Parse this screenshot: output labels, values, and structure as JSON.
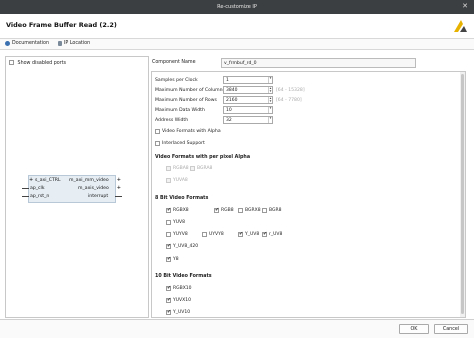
{
  "window": {
    "title": "Re-customize IP",
    "close_glyph": "✕"
  },
  "header": {
    "ip_title": "Video Frame Buffer Read (2.2)",
    "logo_icon": "xilinx-logo-icon",
    "logo_color": "#e8b200"
  },
  "nav": {
    "documentation": "Documentation",
    "ip_location": "IP Location"
  },
  "left": {
    "show_disabled_ports": "Show disabled ports",
    "block": {
      "ports_left": [
        "s_axi_CTRL",
        "ap_clk",
        "ap_rst_n"
      ],
      "ports_right": [
        "m_axi_mm_video",
        "m_axis_video",
        "interrupt"
      ]
    }
  },
  "component": {
    "label": "Component Name",
    "value": "v_frmbuf_rd_0"
  },
  "params": {
    "samples_per_clock": {
      "label": "Samples per Clock",
      "value": "1"
    },
    "max_columns": {
      "label": "Maximum Number of Columns",
      "value": "3840",
      "range": "[64 - 15328]"
    },
    "max_rows": {
      "label": "Maximum Number of Rows",
      "value": "2160",
      "range": "[64 - 7780]"
    },
    "max_data_width": {
      "label": "Maximum Data Width",
      "value": "10"
    },
    "address_width": {
      "label": "Address Width",
      "value": "32"
    },
    "video_formats_alpha": {
      "label": "Video Formats with Alpha",
      "checked": false
    },
    "interlaced": {
      "label": "Interlaced Support",
      "checked": false
    }
  },
  "sections": {
    "alpha": {
      "title": "Video Formats with per pixel Alpha",
      "row1": [
        "RGBA8",
        "BGRA8"
      ],
      "row2": [
        "YUVA8"
      ]
    },
    "bit8": {
      "title": "8 Bit Video Formats",
      "row1": [
        {
          "l": "RGBX8",
          "c": true
        },
        {
          "l": "RGB8",
          "c": true
        },
        {
          "l": "BGRX8",
          "c": false
        },
        {
          "l": "BGR8",
          "c": false
        }
      ],
      "row2": [
        {
          "l": "YUV8",
          "c": false
        }
      ],
      "row3": [
        {
          "l": "YUYV8",
          "c": false
        },
        {
          "l": "UYVY8",
          "c": false
        },
        {
          "l": "Y_UV8",
          "c": true
        },
        {
          "l": "r_UV8",
          "c": true
        }
      ],
      "row4": [
        {
          "l": "Y_UV8_420",
          "c": true
        }
      ],
      "row5": [
        {
          "l": "Y8",
          "c": true
        }
      ]
    },
    "bit10": {
      "title": "10 Bit Video Formats",
      "row1": [
        {
          "l": "RGBX10",
          "c": true
        }
      ],
      "row2": [
        {
          "l": "YUVX10",
          "c": true
        }
      ],
      "row3": [
        {
          "l": "Y_UV10",
          "c": true
        }
      ]
    }
  },
  "footer": {
    "ok": "OK",
    "cancel": "Cancel"
  }
}
